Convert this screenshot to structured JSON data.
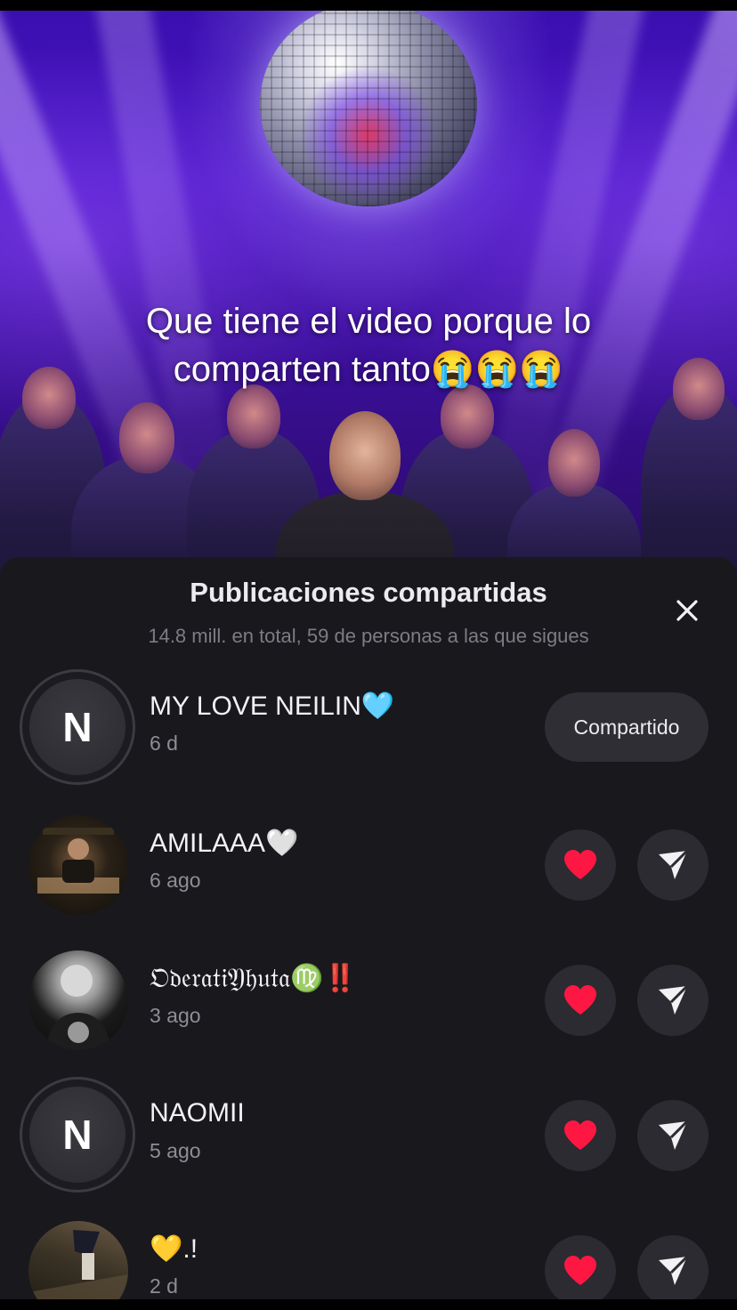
{
  "video": {
    "caption_line1": "Que tiene el video porque lo",
    "caption_line2": "comparten tanto😭😭😭"
  },
  "sheet": {
    "title": "Publicaciones compartidas",
    "subtitle": "14.8 mill. en total, 59 de personas a las que sigues",
    "close_icon": "close-icon"
  },
  "users": [
    {
      "initial": "N",
      "name": "MY LOVE NEILIN🩵",
      "time": "6 d",
      "action": "Compartido"
    },
    {
      "initial": "",
      "name": "AMILAAA🤍",
      "time": "6 ago"
    },
    {
      "initial": "",
      "name": "𝔒𝔡𝔢𝔯𝔞𝔱𝔦𝔜𝔥𝔲𝔱𝔞♍‼️",
      "time": "3 ago"
    },
    {
      "initial": "N",
      "name": "NAOMII",
      "time": "5 ago"
    },
    {
      "initial": "",
      "name": "💛.!",
      "time": "2 d"
    }
  ],
  "colors": {
    "sheet_bg": "#19181d",
    "heart": "#ff1744",
    "video_purple": "#4a16c4"
  },
  "icons": [
    "heart-icon",
    "send-arrow-icon",
    "close-icon"
  ]
}
